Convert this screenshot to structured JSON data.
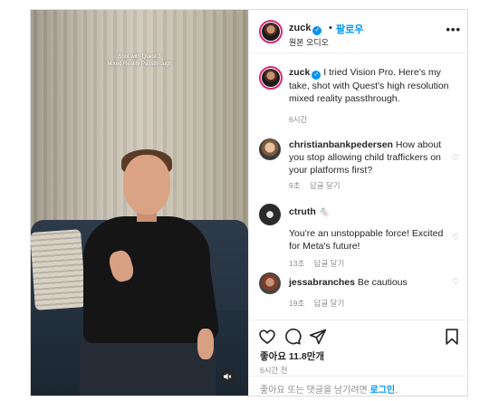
{
  "video": {
    "overlay_line1": "Shot with Quest 3",
    "overlay_line2": "Mixed Reality Passthrough",
    "mute_icon": "speaker-muted-icon"
  },
  "header": {
    "username": "zuck",
    "separator": "•",
    "follow_label": "팔로우",
    "subtitle": "원본 오디오",
    "more_label": "•••"
  },
  "caption": {
    "username": "zuck",
    "text": "I tried Vision Pro. Here's my take, shot with Quest's high resolution mixed reality passthrough.",
    "time": "6시간"
  },
  "comments": [
    {
      "username": "christianbankpedersen",
      "text": "How about you stop allowing child traffickers on your platforms first?",
      "time": "9초",
      "reply_label": "답글 달기"
    },
    {
      "username": "ctruth",
      "badge": "🐁",
      "text": "You're an unstoppable force! Excited for Meta's future!",
      "time": "13초",
      "reply_label": "답글 달기"
    },
    {
      "username": "jessabranches",
      "text": "Be cautious",
      "time": "19초",
      "reply_label": "답글 달기"
    }
  ],
  "actions": {
    "like_icon": "heart-icon",
    "comment_icon": "comment-icon",
    "share_icon": "share-icon",
    "save_icon": "bookmark-icon"
  },
  "likes_text": "좋아요 11.8만개",
  "post_time": "6시간 전",
  "footer": {
    "prompt": "좋아요 또는 댓글을 남기려면",
    "login_label": "로그인",
    "suffix": "."
  },
  "colors": {
    "accent": "#0095f6",
    "border": "#dbdbdb",
    "muted_text": "#8e8e8e",
    "primary_text": "#262626"
  }
}
